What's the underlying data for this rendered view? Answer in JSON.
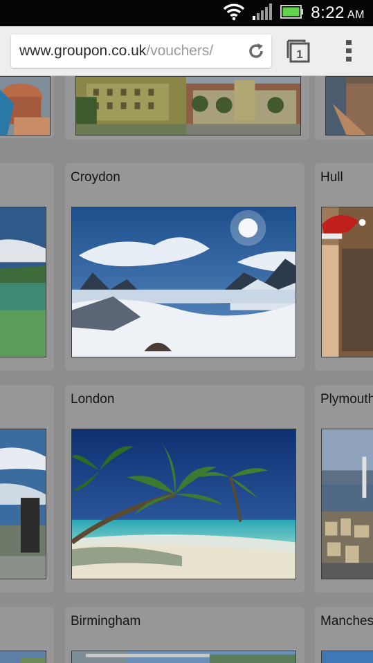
{
  "status_bar": {
    "time": "8:22",
    "ampm": "AM",
    "icons": [
      "wifi-icon",
      "signal-icon",
      "battery-icon"
    ]
  },
  "browser": {
    "url_host": "www.groupon.co.uk",
    "url_path": "/vouchers/",
    "tab_count": "1",
    "icons": [
      "reload-icon",
      "tabs-icon",
      "menu-icon"
    ]
  },
  "cities": [
    {
      "name": "Croydon"
    },
    {
      "name": "Hull"
    },
    {
      "name": "London"
    },
    {
      "name": "Plymouth"
    },
    {
      "name": "Birmingham"
    },
    {
      "name": "Manchester"
    }
  ],
  "colors": {
    "status_bar": "#050505",
    "toolbar": "#eeeeee",
    "overlay_background": "#8d8d8d",
    "battery": "#5fd34a"
  }
}
